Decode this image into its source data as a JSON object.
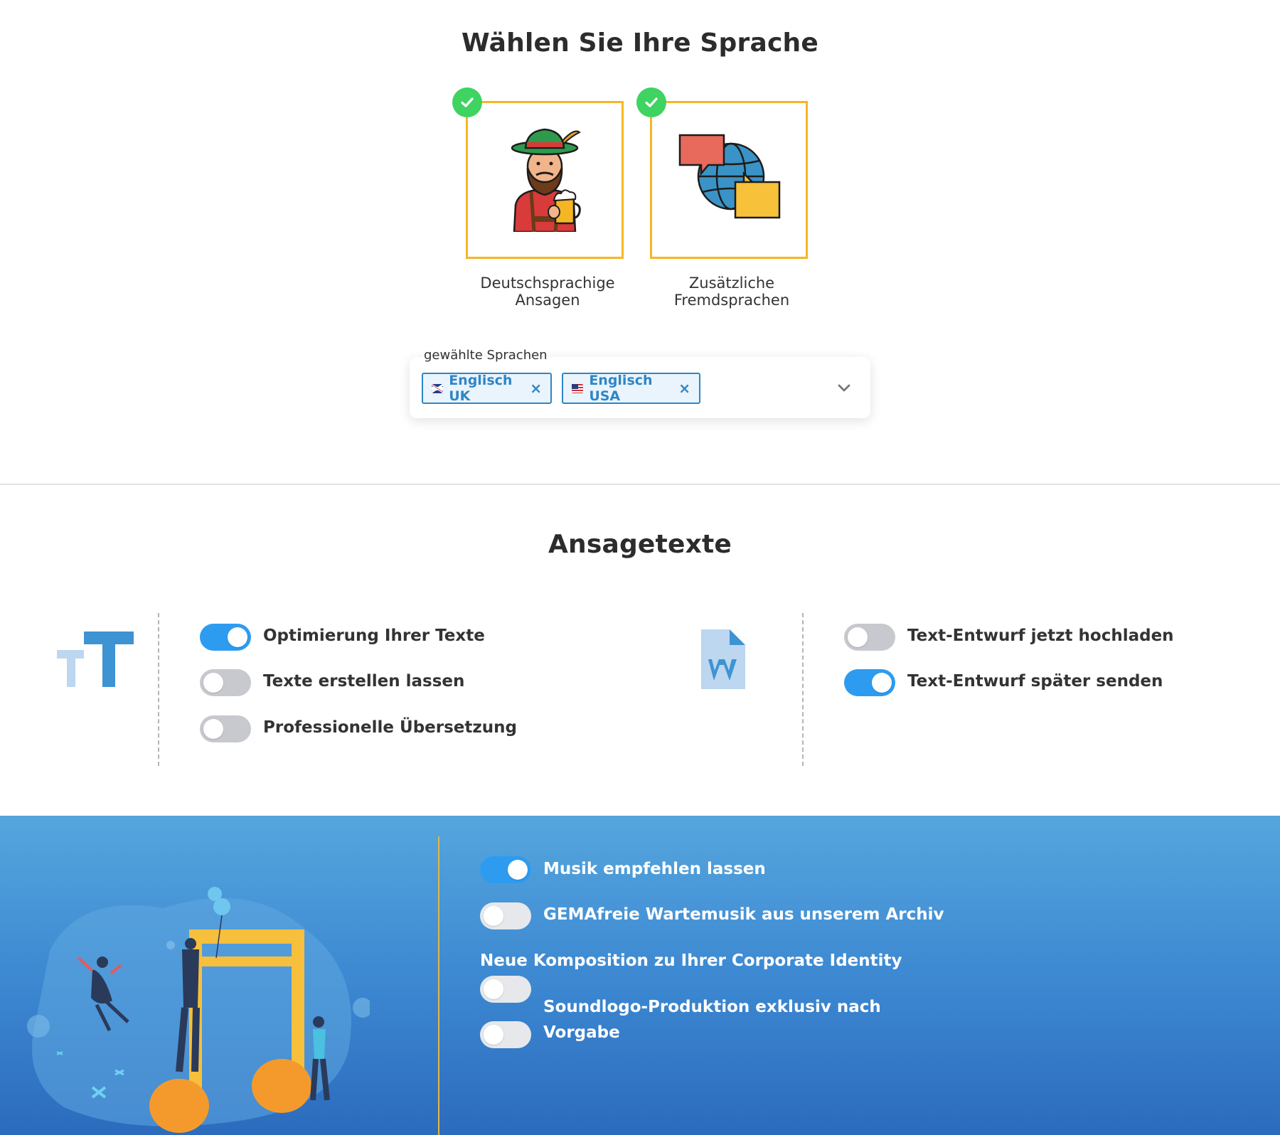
{
  "language_section": {
    "title": "Wählen Sie Ihre Sprache",
    "cards": [
      {
        "label": "Deutschsprachige Ansagen",
        "selected": true,
        "icon": "bavarian-man-with-beer-icon"
      },
      {
        "label": "Zusätzliche Fremdsprachen",
        "selected": true,
        "icon": "globe-with-speech-bubbles-icon"
      }
    ],
    "select": {
      "caption": "gewählte Sprachen",
      "chips": [
        {
          "label": "Englisch UK",
          "flag": "uk-flag-icon"
        },
        {
          "label": "Englisch USA",
          "flag": "us-flag-icon"
        }
      ],
      "remove_symbol": "×"
    }
  },
  "texts_section": {
    "title": "Ansagetexte",
    "left_options": [
      {
        "label": "Optimierung Ihrer Texte",
        "on": true
      },
      {
        "label": "Texte erstellen lassen",
        "on": false
      },
      {
        "label": "Professionelle Übersetzung",
        "on": false
      }
    ],
    "right_options": [
      {
        "label": "Text-Entwurf jetzt hochladen",
        "on": false
      },
      {
        "label": "Text-Entwurf später senden",
        "on": true
      }
    ]
  },
  "music_section": {
    "options": [
      {
        "label": "Musik empfehlen lassen",
        "on": true
      },
      {
        "label": "GEMAfreie Wartemusik aus unserem Archiv",
        "on": false
      }
    ],
    "composition_heading": "Neue Komposition zu Ihrer Corporate Identity",
    "composition_toggle_on": false,
    "soundlogo": {
      "label_line1": "Soundlogo-Produktion exklusiv nach",
      "label_line2": "Vorgabe",
      "on": false
    }
  },
  "colors": {
    "accent_blue": "#2d9cf0",
    "card_border": "#f6b624",
    "check_green": "#3fd361",
    "chip_blue": "#2f86c6"
  }
}
